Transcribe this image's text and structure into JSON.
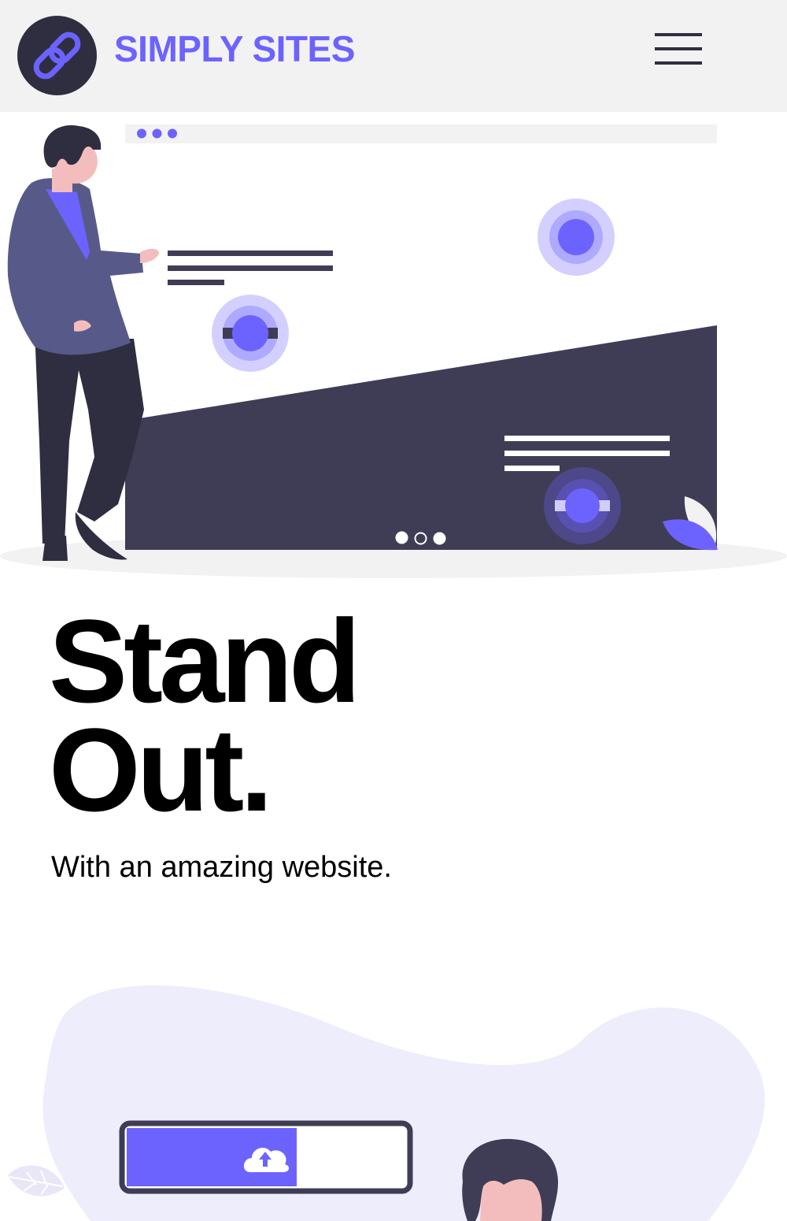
{
  "header": {
    "brand": "SIMPLY SITES",
    "logo_icon": "link-icon",
    "menu_icon": "hamburger-menu-icon"
  },
  "hero": {
    "headline_line1": "Stand",
    "headline_line2": "Out.",
    "subtitle": "With an amazing website."
  },
  "carousel": {
    "dot_count": 3,
    "active_index": 1
  },
  "upload_widget": {
    "icon": "cloud-upload-icon",
    "progress": 0.6
  },
  "colors": {
    "accent": "#6c63ff",
    "dark": "#2f2e41",
    "slate": "#3f3d56",
    "header_bg": "#f2f2f2",
    "blob_bg": "#eeedfb"
  }
}
